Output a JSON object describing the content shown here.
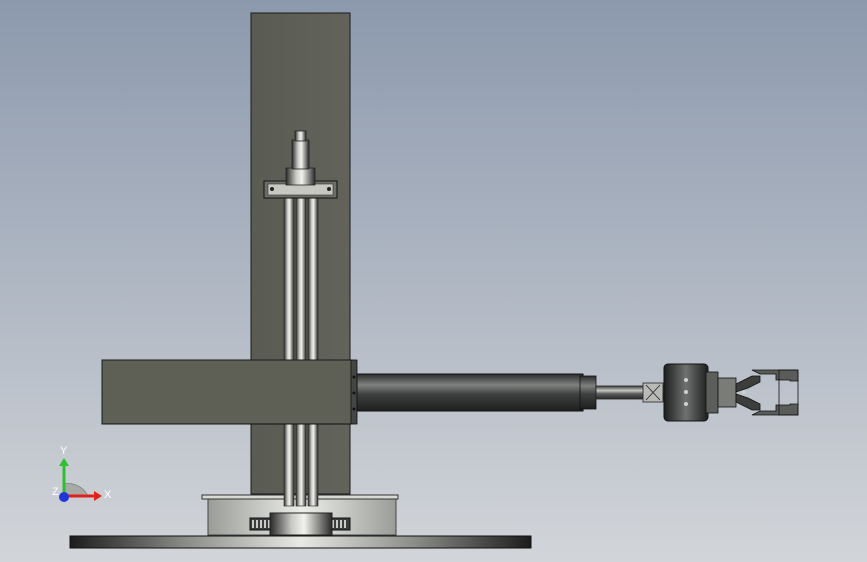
{
  "colors": {
    "background_top": "#8c99ad",
    "background_bottom": "#d2d5d9",
    "column_fill": "#5e5f55",
    "arm_housing_fill": "#5e5f55",
    "steel_dark": "#3a3c3c",
    "steel_mid": "#8e908e",
    "steel_light": "#e2e3e0",
    "outline": "#1a1a1a",
    "axis_x": "#e0201b",
    "axis_y": "#2fbf2f",
    "axis_z": "#2036d8"
  },
  "triad": {
    "x_label": "X",
    "y_label": "Y",
    "z_label": "Z"
  }
}
